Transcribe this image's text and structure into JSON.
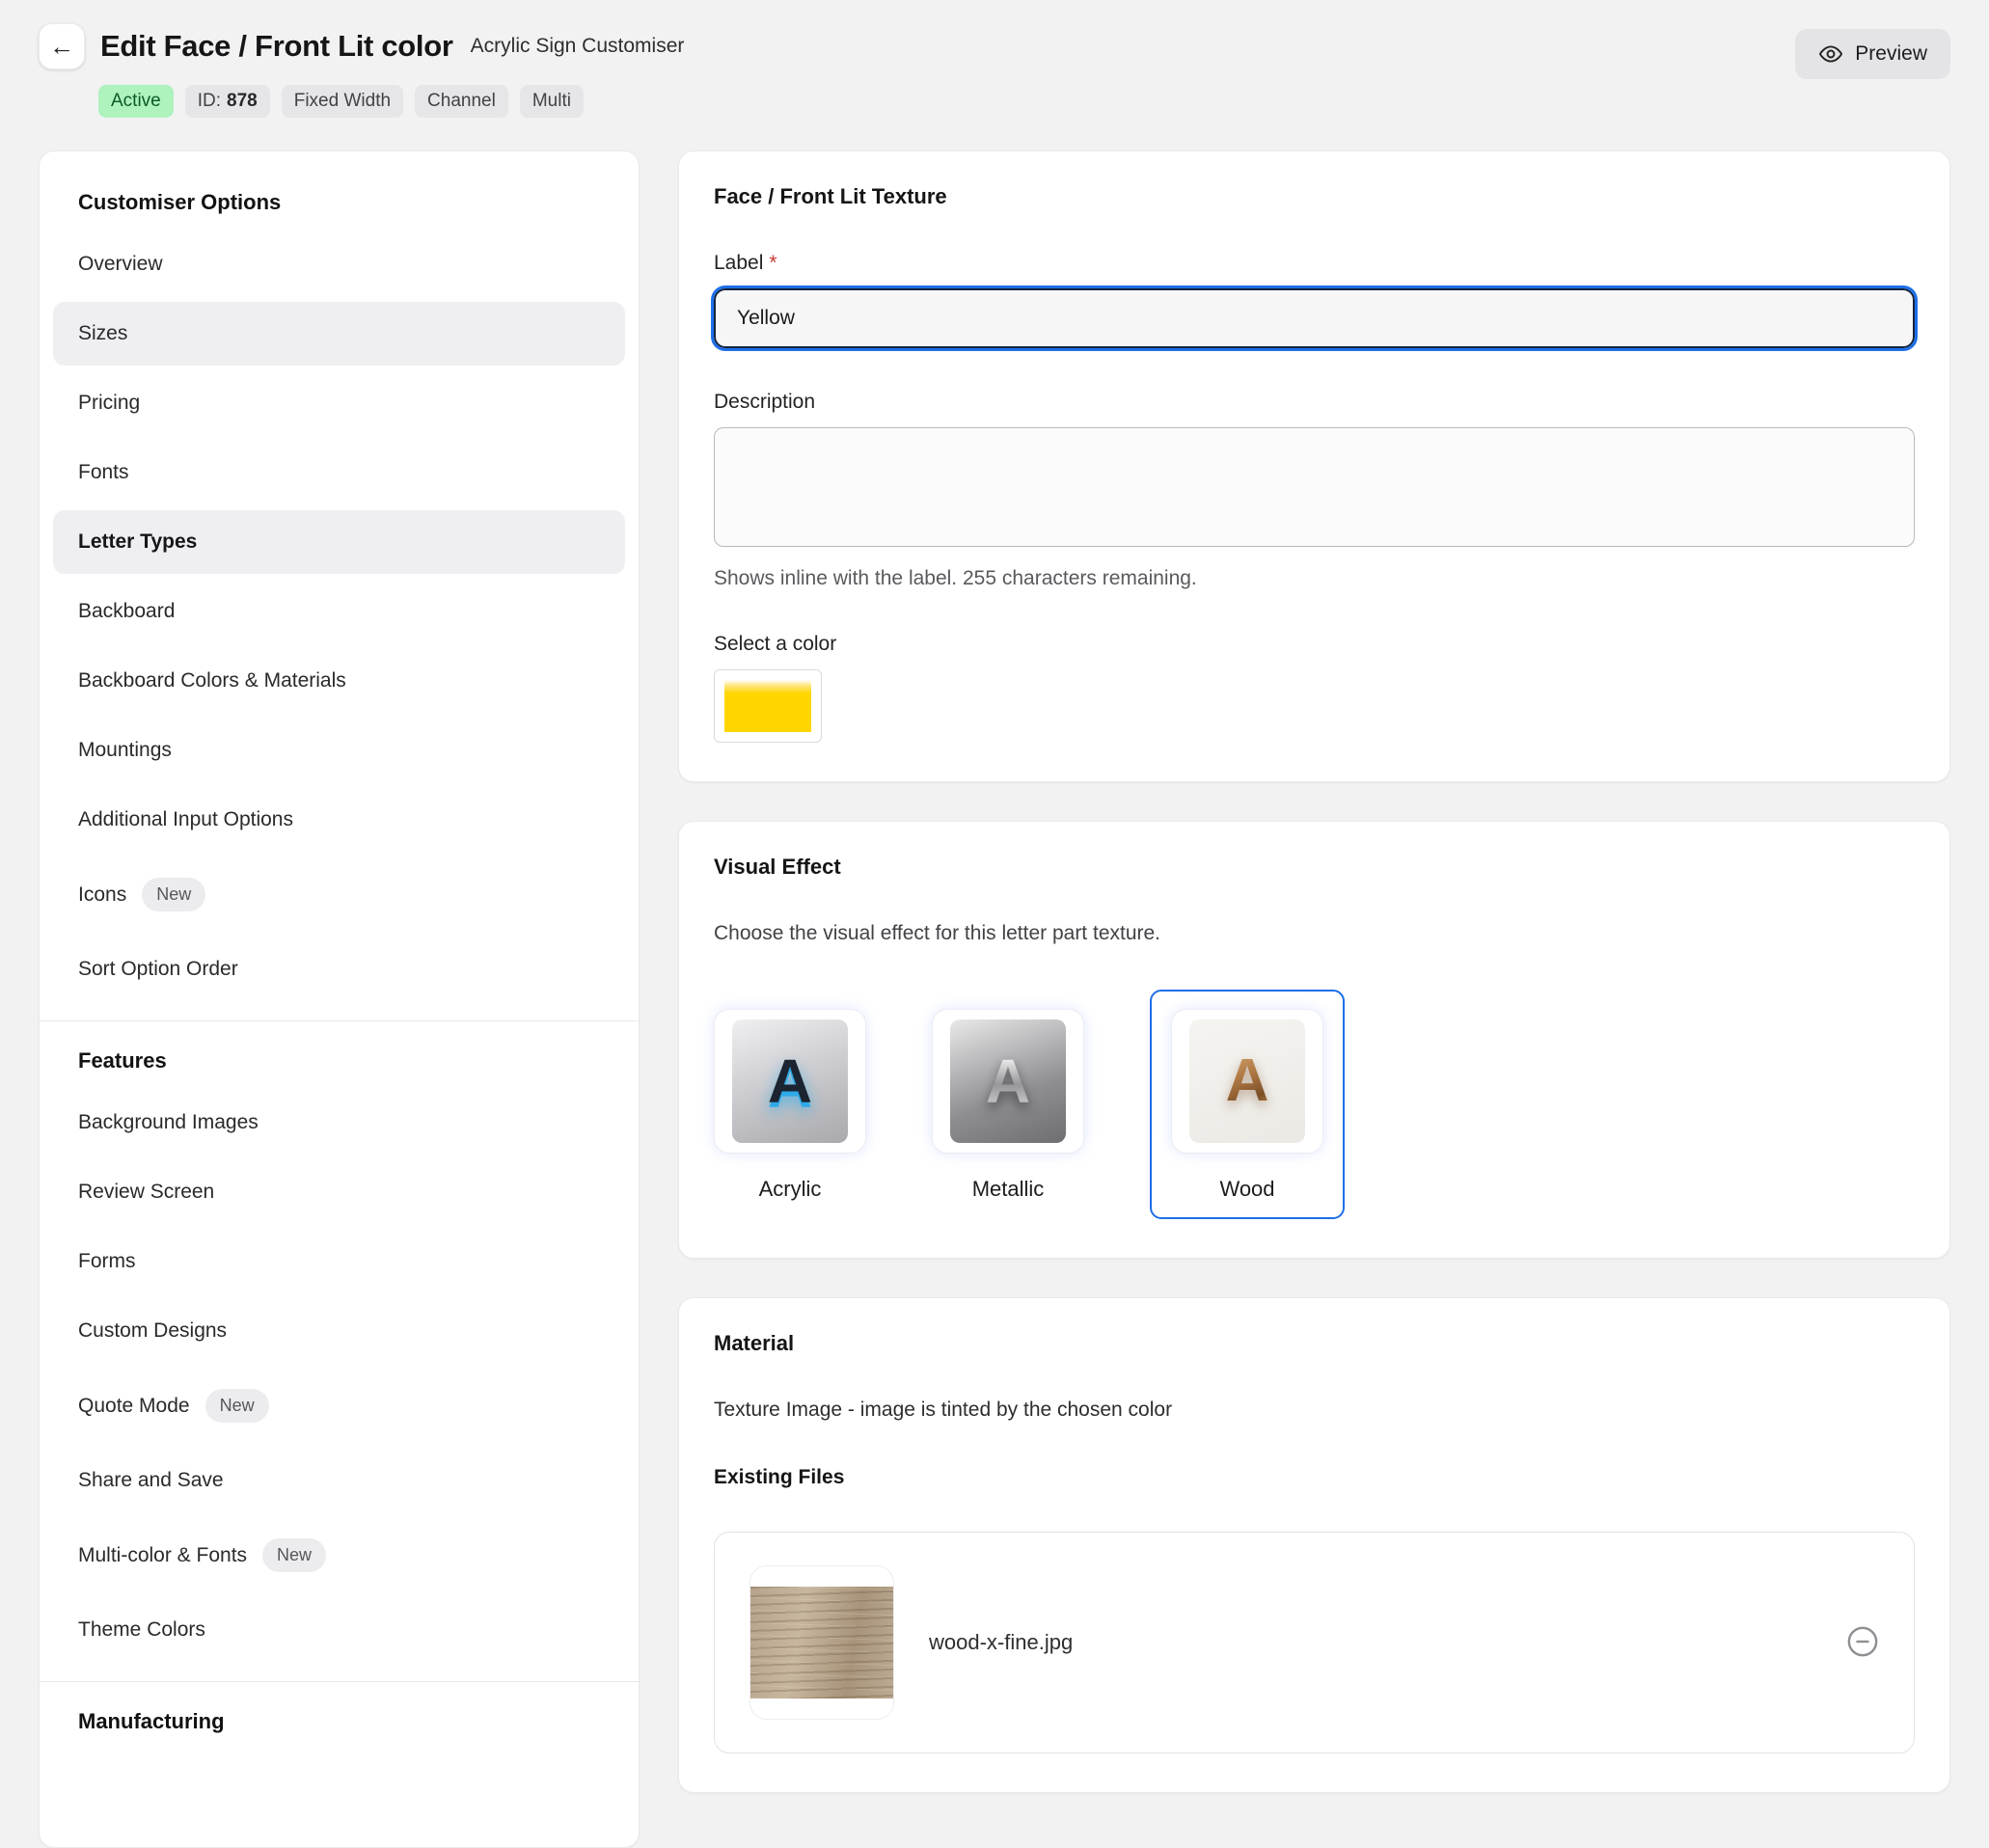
{
  "header": {
    "title": "Edit Face / Front Lit color",
    "subtitle": "Acrylic Sign Customiser",
    "preview_label": "Preview",
    "badges": {
      "active": "Active",
      "id_label": "ID:",
      "id_value": "878",
      "fixed_width": "Fixed Width",
      "channel": "Channel",
      "multi": "Multi"
    }
  },
  "sidebar": {
    "sections": [
      {
        "heading": "Customiser Options",
        "items": [
          {
            "label": "Overview"
          },
          {
            "label": "Sizes",
            "highlighted": true
          },
          {
            "label": "Pricing"
          },
          {
            "label": "Fonts"
          },
          {
            "label": "Letter Types",
            "highlighted": true,
            "active": true
          },
          {
            "label": "Backboard"
          },
          {
            "label": "Backboard Colors & Materials"
          },
          {
            "label": "Mountings"
          },
          {
            "label": "Additional Input Options"
          },
          {
            "label": "Icons",
            "badge": "New"
          },
          {
            "label": "Sort Option Order"
          }
        ]
      },
      {
        "heading": "Features",
        "items": [
          {
            "label": "Background Images"
          },
          {
            "label": "Review Screen"
          },
          {
            "label": "Forms"
          },
          {
            "label": "Custom Designs"
          },
          {
            "label": "Quote Mode",
            "badge": "New"
          },
          {
            "label": "Share and Save"
          },
          {
            "label": "Multi-color & Fonts",
            "badge": "New"
          },
          {
            "label": "Theme Colors"
          }
        ]
      },
      {
        "heading": "Manufacturing",
        "items": []
      }
    ]
  },
  "texture_card": {
    "heading": "Face / Front Lit Texture",
    "label_field": {
      "label": "Label",
      "required_mark": "*",
      "value": "Yellow"
    },
    "description_field": {
      "label": "Description",
      "value": ""
    },
    "helper_text": "Shows inline with the label. 255 characters remaining.",
    "color_section": {
      "label": "Select a color",
      "value": "#FFD600"
    }
  },
  "effect_card": {
    "heading": "Visual Effect",
    "description": "Choose the visual effect for this letter part texture.",
    "options": [
      {
        "label": "Acrylic",
        "letter": "A",
        "selected": false
      },
      {
        "label": "Metallic",
        "letter": "A",
        "selected": false
      },
      {
        "label": "Wood",
        "letter": "A",
        "selected": true
      }
    ]
  },
  "material_card": {
    "heading": "Material",
    "texture_note": "Texture Image - image is tinted by the chosen color",
    "files_heading": "Existing Files",
    "files": [
      {
        "name": "wood-x-fine.jpg"
      }
    ]
  },
  "colors": {
    "accent_blue": "#1E6FE8",
    "swatch_yellow": "#FFD600",
    "active_badge_bg": "#AEF2BE",
    "active_badge_text": "#0B5B28"
  }
}
